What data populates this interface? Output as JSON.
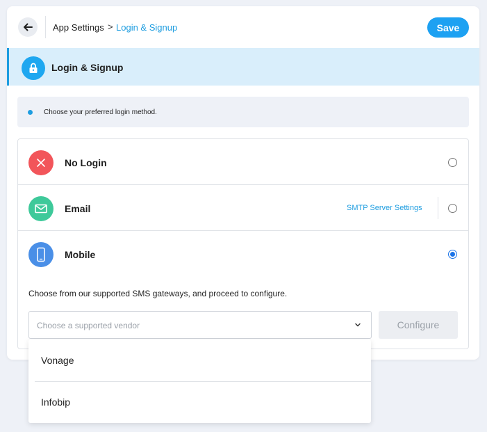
{
  "header": {
    "breadcrumb_root": "App Settings",
    "breadcrumb_separator": ">",
    "breadcrumb_current": "Login & Signup",
    "save_label": "Save"
  },
  "section": {
    "title": "Login & Signup",
    "icon": "lock-icon"
  },
  "info": {
    "text": "Choose your preferred login method."
  },
  "options": [
    {
      "label": "No Login",
      "icon": "close-icon",
      "icon_color": "#f2555a",
      "selected": false
    },
    {
      "label": "Email",
      "icon": "mail-icon",
      "icon_color": "#3ec99a",
      "selected": false,
      "link": "SMTP Server Settings"
    },
    {
      "label": "Mobile",
      "icon": "phone-icon",
      "icon_color": "#4a8fe7",
      "selected": true
    }
  ],
  "mobile": {
    "gateway_text": "Choose from our supported SMS gateways, and proceed to configure.",
    "vendor_placeholder": "Choose a supported vendor",
    "configure_label": "Configure"
  },
  "dropdown": {
    "items": [
      "Vonage",
      "Infobip"
    ]
  },
  "colors": {
    "accent": "#1da1f2",
    "banner_bg": "#d9eefb",
    "page_bg": "#eef1f7"
  }
}
